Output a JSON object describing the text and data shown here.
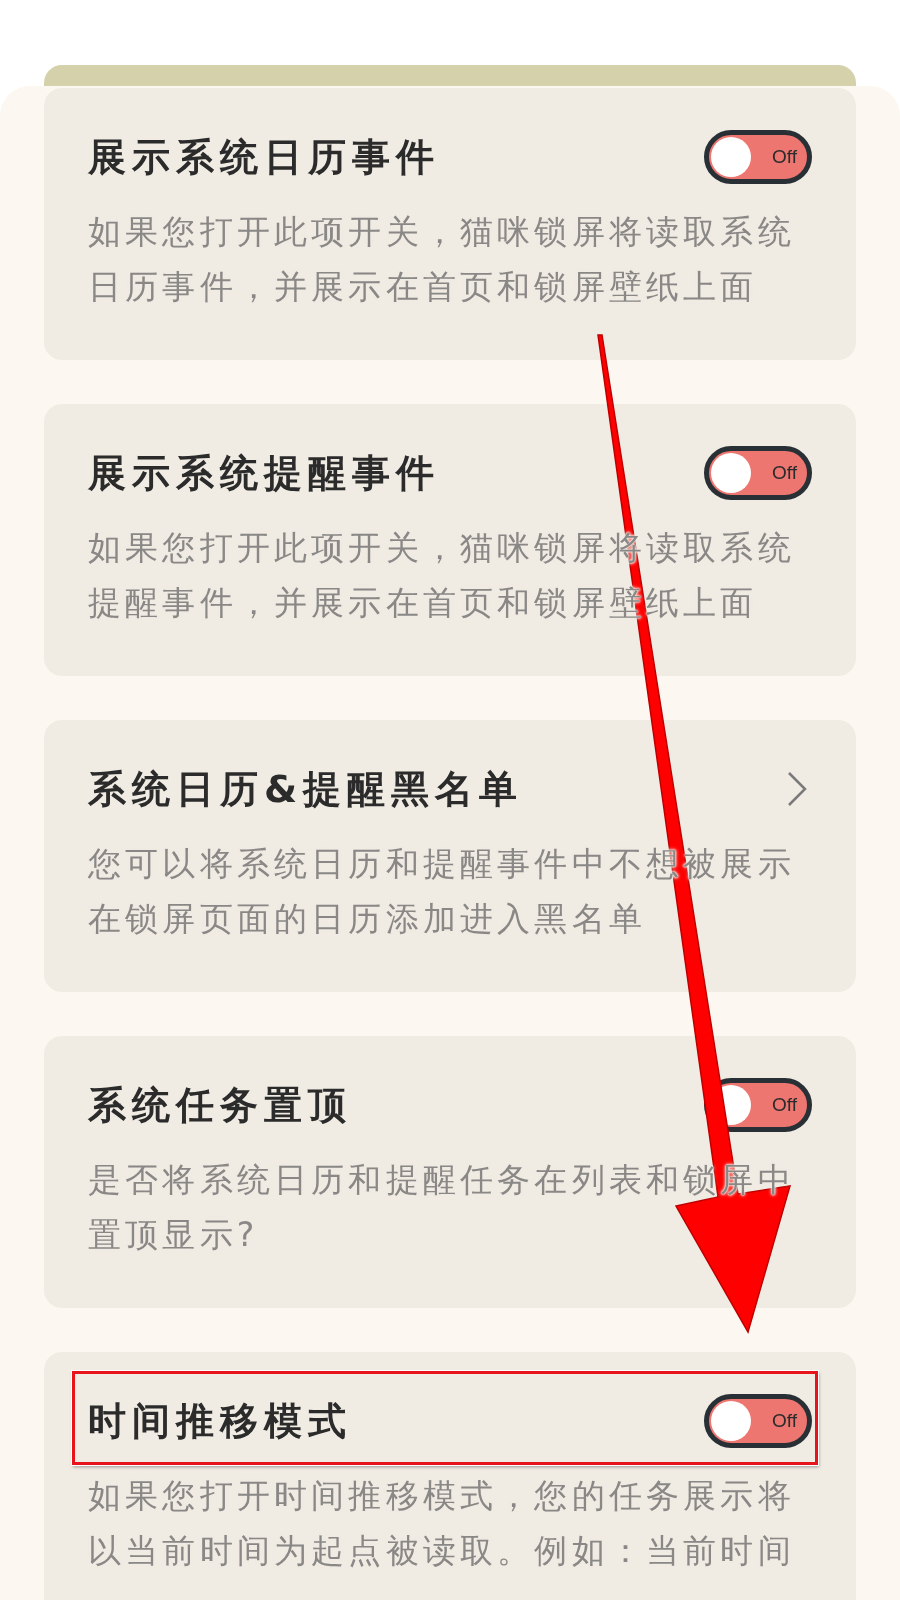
{
  "items": [
    {
      "kind": "toggle",
      "title": "展示系统日历事件",
      "description": "如果您打开此项开关，猫咪锁屏将读取系统日历事件，并展示在首页和锁屏壁纸上面",
      "on": false,
      "toggle_label": "Off",
      "highlighted": false
    },
    {
      "kind": "toggle",
      "title": "展示系统提醒事件",
      "description": "如果您打开此项开关，猫咪锁屏将读取系统提醒事件，并展示在首页和锁屏壁纸上面",
      "on": false,
      "toggle_label": "Off",
      "highlighted": false
    },
    {
      "kind": "link",
      "title": "系统日历&提醒黑名单",
      "description": "您可以将系统日历和提醒事件中不想被展示在锁屏页面的日历添加进入黑名单",
      "highlighted": false
    },
    {
      "kind": "toggle",
      "title": "系统任务置顶",
      "description": "是否将系统日历和提醒任务在列表和锁屏中置顶显示?",
      "on": false,
      "toggle_label": "Off",
      "highlighted": false
    },
    {
      "kind": "toggle",
      "title": "时间推移模式",
      "description": "如果您打开时间推移模式，您的任务展示将以当前时间为起点被读取。例如：当前时间",
      "on": false,
      "toggle_label": "Off",
      "highlighted": true
    }
  ]
}
